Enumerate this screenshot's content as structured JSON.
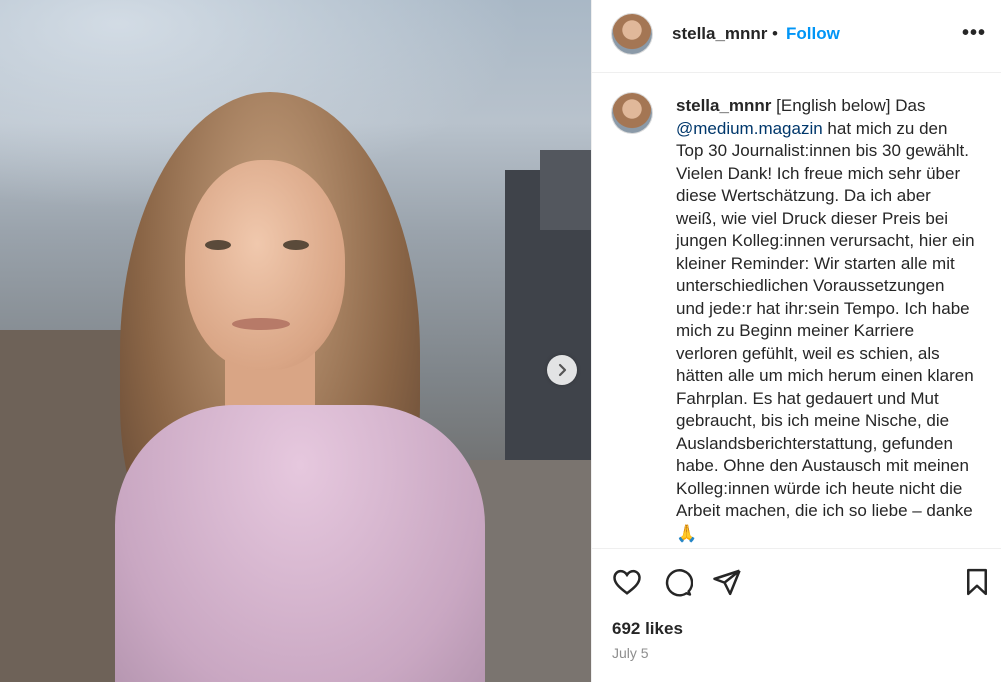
{
  "post": {
    "photo_alt_icon": "portrait-photo",
    "next_icon": "chevron-right-icon"
  },
  "header": {
    "username": "stella_mnnr",
    "separator": "•",
    "follow_label": "Follow",
    "more_label": "•••"
  },
  "caption": {
    "username": "stella_mnnr",
    "part1": " [English below] Das ",
    "mention": "@medium.magazin",
    "part2": " hat mich zu den Top 30 Journalist:innen bis 30 gewählt. Vielen Dank! Ich freue mich sehr über diese Wertschätzung. Da ich aber weiß, wie viel Druck dieser Preis bei jungen Kolleg:innen verursacht, hier ein kleiner Reminder: Wir starten alle mit unterschiedlichen Voraussetzungen und jede:r hat ihr:sein Tempo. Ich habe mich zu Beginn meiner Karriere verloren gefühlt, weil es schien, als hätten alle um mich herum einen klaren Fahrplan. Es hat gedauert und Mut gebraucht, bis ich meine Nische, die Auslandsberichterstattung, gefunden habe. Ohne den Austausch mit meinen Kolleg:innen würde ich heute nicht die Arbeit machen, die ich so liebe – danke 🙏"
  },
  "actions": {
    "like_icon": "heart-icon",
    "comment_icon": "comment-icon",
    "share_icon": "share-icon",
    "save_icon": "bookmark-icon"
  },
  "stats": {
    "likes": "692 likes",
    "date": "July 5"
  },
  "colors": {
    "follow": "#0095f6",
    "mention": "#00376b",
    "muted": "#8e8e8e"
  }
}
